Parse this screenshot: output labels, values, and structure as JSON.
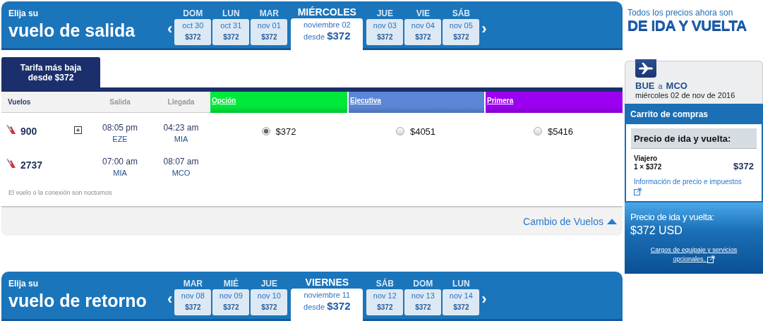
{
  "outbound": {
    "kicker": "Elija su",
    "title": "vuelo de salida",
    "prev": "‹",
    "next": "›",
    "days": [
      {
        "weekday": "DOM",
        "date": "oct 30",
        "price": "$372",
        "selected": false
      },
      {
        "weekday": "LUN",
        "date": "oct 31",
        "price": "$372",
        "selected": false
      },
      {
        "weekday": "MAR",
        "date": "nov 01",
        "price": "$372",
        "selected": false
      },
      {
        "weekday": "MIÉRCOLES",
        "date": "noviembre 02",
        "price_prefix": "desde",
        "price": "$372",
        "selected": true
      },
      {
        "weekday": "JUE",
        "date": "nov 03",
        "price": "$372",
        "selected": false
      },
      {
        "weekday": "VIE",
        "date": "nov 04",
        "price": "$372",
        "selected": false
      },
      {
        "weekday": "SÁB",
        "date": "nov 05",
        "price": "$372",
        "selected": false
      }
    ]
  },
  "results": {
    "tab": {
      "line1": "Tarifa más baja",
      "line2": "desde $372"
    },
    "columns": [
      "Vuelos",
      "Salida",
      "Llegada"
    ],
    "fare_columns": [
      {
        "label": "Opción",
        "color": "#00e83a"
      },
      {
        "label": "Ejecutiva",
        "color": "#5b86d8"
      },
      {
        "label": "Primera",
        "color": "#9b00f0"
      }
    ],
    "segments": [
      {
        "number": "900",
        "expandable": true,
        "departure": "08:05 pm",
        "from": "EZE",
        "arrival": "04:23 am",
        "to": "MIA",
        "fares": [
          {
            "price": "$372",
            "selected": true
          },
          {
            "price": "$4051",
            "selected": false
          },
          {
            "price": "$5416",
            "selected": false
          }
        ]
      },
      {
        "number": "2737",
        "expandable": false,
        "departure": "07:00 am",
        "from": "MIA",
        "arrival": "08:07 am",
        "to": "MCO"
      }
    ],
    "note": "El vuelo o la conexión son nocturnos",
    "change_link": "Cambio de Vuelos"
  },
  "return": {
    "kicker": "Elija su",
    "title": "vuelo de retorno",
    "prev": "‹",
    "next": "›",
    "days": [
      {
        "weekday": "MAR",
        "date": "nov 08",
        "price": "$372",
        "selected": false
      },
      {
        "weekday": "MIÉ",
        "date": "nov 09",
        "price": "$372",
        "selected": false
      },
      {
        "weekday": "JUE",
        "date": "nov 10",
        "price": "$372",
        "selected": false
      },
      {
        "weekday": "VIERNES",
        "date": "noviembre 11",
        "price_prefix": "desde",
        "price": "$372",
        "selected": true
      },
      {
        "weekday": "SÁB",
        "date": "nov 12",
        "price": "$372",
        "selected": false
      },
      {
        "weekday": "DOM",
        "date": "nov 13",
        "price": "$372",
        "selected": false
      },
      {
        "weekday": "LUN",
        "date": "nov 14",
        "price": "$372",
        "selected": false
      }
    ]
  },
  "promo": {
    "line1": "Todos los precios ahora son",
    "line2": "DE IDA Y VUELTA"
  },
  "route": {
    "from": "BUE",
    "connector": "a",
    "to": "MCO",
    "date": "miércoles 02 de nov de 2016"
  },
  "cart": {
    "title": "Carrito de compras",
    "heading": "Precio de ida y vuelta:",
    "traveler": "Viajero",
    "quantity": "1 × $372",
    "amount": "$372",
    "info_link": "Información de precio e impuestos"
  },
  "total": {
    "label": "Precio de ida y vuelta:",
    "amount": "$372 USD",
    "link": "Cargos de equipaje y servicios opcionales."
  }
}
